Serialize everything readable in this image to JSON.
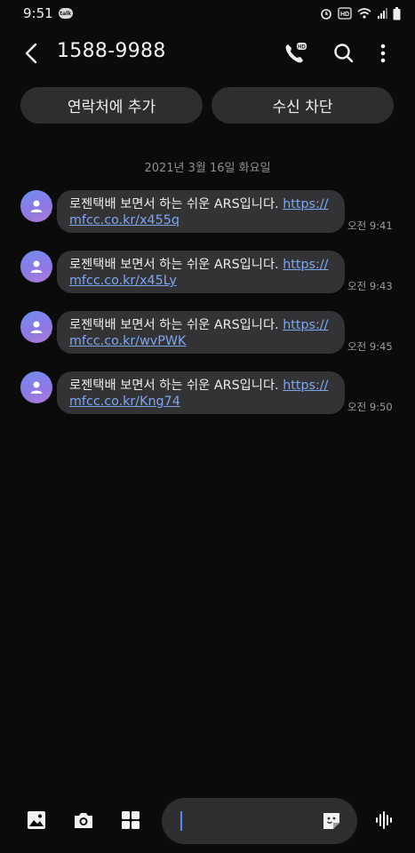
{
  "status_bar": {
    "time": "9:51",
    "talk_label": "talk"
  },
  "header": {
    "title": "1588-9988"
  },
  "actions": {
    "add_contact": "연락처에 추가",
    "block": "수신 차단"
  },
  "date_separator": "2021년 3월 16일 화요일",
  "messages": [
    {
      "text": "로젠택배 보면서 하는 쉬운 ARS입니다. ",
      "link_line1": "https://",
      "link_line2": "mfcc.co.kr/x455q",
      "time": "오전 9:41"
    },
    {
      "text": "로젠택배 보면서 하는 쉬운 ARS입니다. ",
      "link_line1": "https://",
      "link_line2": "mfcc.co.kr/x45Ly",
      "time": "오전 9:43"
    },
    {
      "text": "로젠택배 보면서 하는 쉬운 ARS입니다. ",
      "link_line1": "https://",
      "link_line2": "mfcc.co.kr/wvPWK",
      "time": "오전 9:45"
    },
    {
      "text": "로젠택배 보면서 하는 쉬운 ARS입니다. ",
      "link_line1": "https://",
      "link_line2": "mfcc.co.kr/Kng74",
      "time": "오전 9:50"
    }
  ],
  "composer": {
    "value": ""
  },
  "colors": {
    "background": "#0b0b0c",
    "bubble": "#333336",
    "link": "#7ea7ee",
    "button": "#2e2e31"
  },
  "icons": [
    "back-arrow-icon",
    "hd-call-icon",
    "search-icon",
    "more-vertical-icon",
    "gallery-icon",
    "camera-icon",
    "apps-grid-icon",
    "sticker-icon",
    "voice-wave-icon"
  ]
}
